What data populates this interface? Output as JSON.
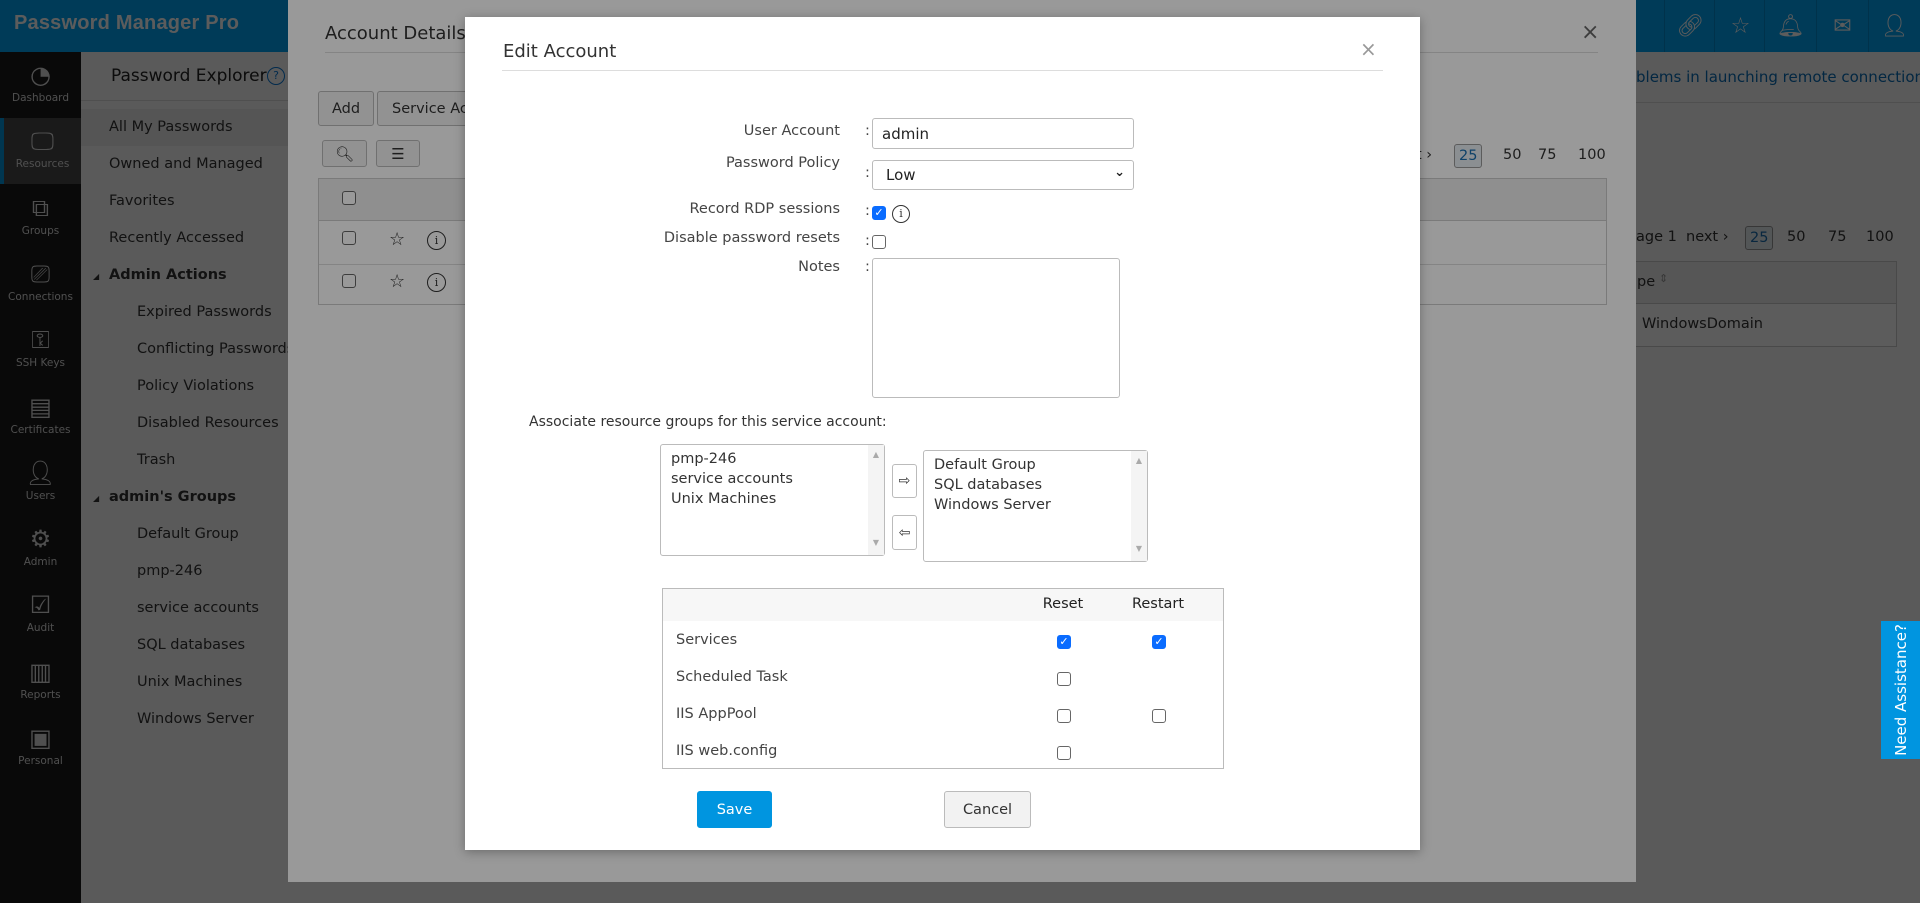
{
  "app": {
    "title": "Password Manager Pro",
    "accent": "#0095e0"
  },
  "header_icons": [
    "link-icon",
    "favorite-user-icon",
    "bell-icon",
    "mail-icon",
    "user-icon"
  ],
  "nav": [
    {
      "label": "Dashboard",
      "icon": "dashboard-icon"
    },
    {
      "label": "Resources",
      "icon": "monitor-icon",
      "active": true
    },
    {
      "label": "Groups",
      "icon": "groups-icon"
    },
    {
      "label": "Connections",
      "icon": "connections-icon"
    },
    {
      "label": "SSH Keys",
      "icon": "ssh-key-icon"
    },
    {
      "label": "Certificates",
      "icon": "certificate-icon"
    },
    {
      "label": "Users",
      "icon": "user-icon"
    },
    {
      "label": "Admin",
      "icon": "gear-icon"
    },
    {
      "label": "Audit",
      "icon": "clipboard-icon"
    },
    {
      "label": "Reports",
      "icon": "bar-chart-icon"
    },
    {
      "label": "Personal",
      "icon": "contact-book-icon"
    }
  ],
  "panel": {
    "title": "Password Explorer",
    "items": [
      {
        "label": "All My Passwords",
        "type": "top",
        "active": true
      },
      {
        "label": "Owned and Managed",
        "type": "top"
      },
      {
        "label": "Favorites",
        "type": "top"
      },
      {
        "label": "Recently Accessed",
        "type": "top"
      },
      {
        "label": "Admin Actions",
        "type": "sec"
      },
      {
        "label": "Expired Passwords",
        "type": "sub"
      },
      {
        "label": "Conflicting Passwords",
        "type": "sub"
      },
      {
        "label": "Policy Violations",
        "type": "sub"
      },
      {
        "label": "Disabled Resources",
        "type": "sub"
      },
      {
        "label": "Trash",
        "type": "sub"
      },
      {
        "label": "admin's Groups",
        "type": "sec"
      },
      {
        "label": "Default Group",
        "type": "sub"
      },
      {
        "label": "pmp-246",
        "type": "sub"
      },
      {
        "label": "service accounts",
        "type": "sub"
      },
      {
        "label": "SQL databases",
        "type": "sub"
      },
      {
        "label": "Unix Machines",
        "type": "sub"
      },
      {
        "label": "Windows Server",
        "type": "sub"
      }
    ]
  },
  "bg": {
    "remote_link": "blems in launching remote connections?",
    "page_text": "age 1",
    "next": "next ›",
    "page_sizes": [
      "25",
      "50",
      "75",
      "100"
    ],
    "col_header": "pe",
    "row_value": "WindowsDomain"
  },
  "account_details": {
    "title": "Account Details -",
    "close": "×",
    "add": "Add",
    "service_accounts": "Service Acc",
    "next": "t ›",
    "page_sizes": [
      "25",
      "50",
      "75",
      "100"
    ]
  },
  "edit": {
    "title": "Edit Account",
    "close": "×",
    "user_account_label": "User Account",
    "user_account_value": "admin",
    "policy_label": "Password Policy",
    "policy_value": "Low",
    "rdp_label": "Record RDP sessions",
    "rdp_checked": true,
    "disable_label": "Disable password resets",
    "disable_checked": false,
    "notes_label": "Notes",
    "notes_value": "",
    "colon": ":",
    "assoc_label": "Associate resource groups for this service account:",
    "available_groups": [
      "pmp-246",
      "service accounts",
      "Unix Machines"
    ],
    "selected_groups": [
      "Default Group",
      "SQL databases",
      "Windows Server"
    ],
    "move_right": "⇨",
    "move_left": "⇦",
    "table": {
      "headers": [
        "Reset",
        "Restart"
      ],
      "rows": [
        {
          "name": "Services",
          "reset": true,
          "restart": true
        },
        {
          "name": "Scheduled Task",
          "reset": false,
          "restart": null
        },
        {
          "name": "IIS AppPool",
          "reset": false,
          "restart": false
        },
        {
          "name": "IIS web.config",
          "reset": false,
          "restart": null
        }
      ]
    },
    "save": "Save",
    "cancel": "Cancel"
  },
  "need_assistance": "Need Assistance?"
}
